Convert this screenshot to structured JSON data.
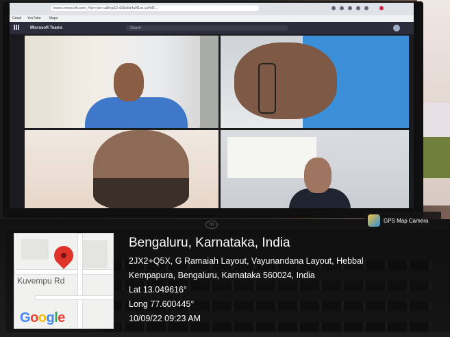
{
  "browser": {
    "url": "teams.microsoft.com/_#/pre-join-calling/19:a93bdfa4a9f1ae.cal4d0...",
    "bookmarks": [
      "Gmail",
      "YouTube",
      "Maps"
    ]
  },
  "teams": {
    "app_title": "Microsoft Teams",
    "search_placeholder": "Search"
  },
  "gps_badge": {
    "label": "GPS Map Camera"
  },
  "map": {
    "road_label": "Kuvempu Rd",
    "logo_letters": [
      {
        "ch": "G",
        "color": "#4285F4"
      },
      {
        "ch": "o",
        "color": "#EA4335"
      },
      {
        "ch": "o",
        "color": "#FBBC05"
      },
      {
        "ch": "g",
        "color": "#4285F4"
      },
      {
        "ch": "l",
        "color": "#34A853"
      },
      {
        "ch": "e",
        "color": "#EA4335"
      }
    ]
  },
  "location": {
    "city": "Bengaluru, Karnataka, India",
    "address_line1": "2JX2+Q5X, G Ramaiah Layout, Vayunandana Layout, Hebbal",
    "address_line2": "Kempapura, Bengaluru, Karnataka 560024, India",
    "lat": "Lat 13.049616°",
    "long": "Long 77.600445°",
    "datetime": "10/09/22 09:23 AM"
  }
}
